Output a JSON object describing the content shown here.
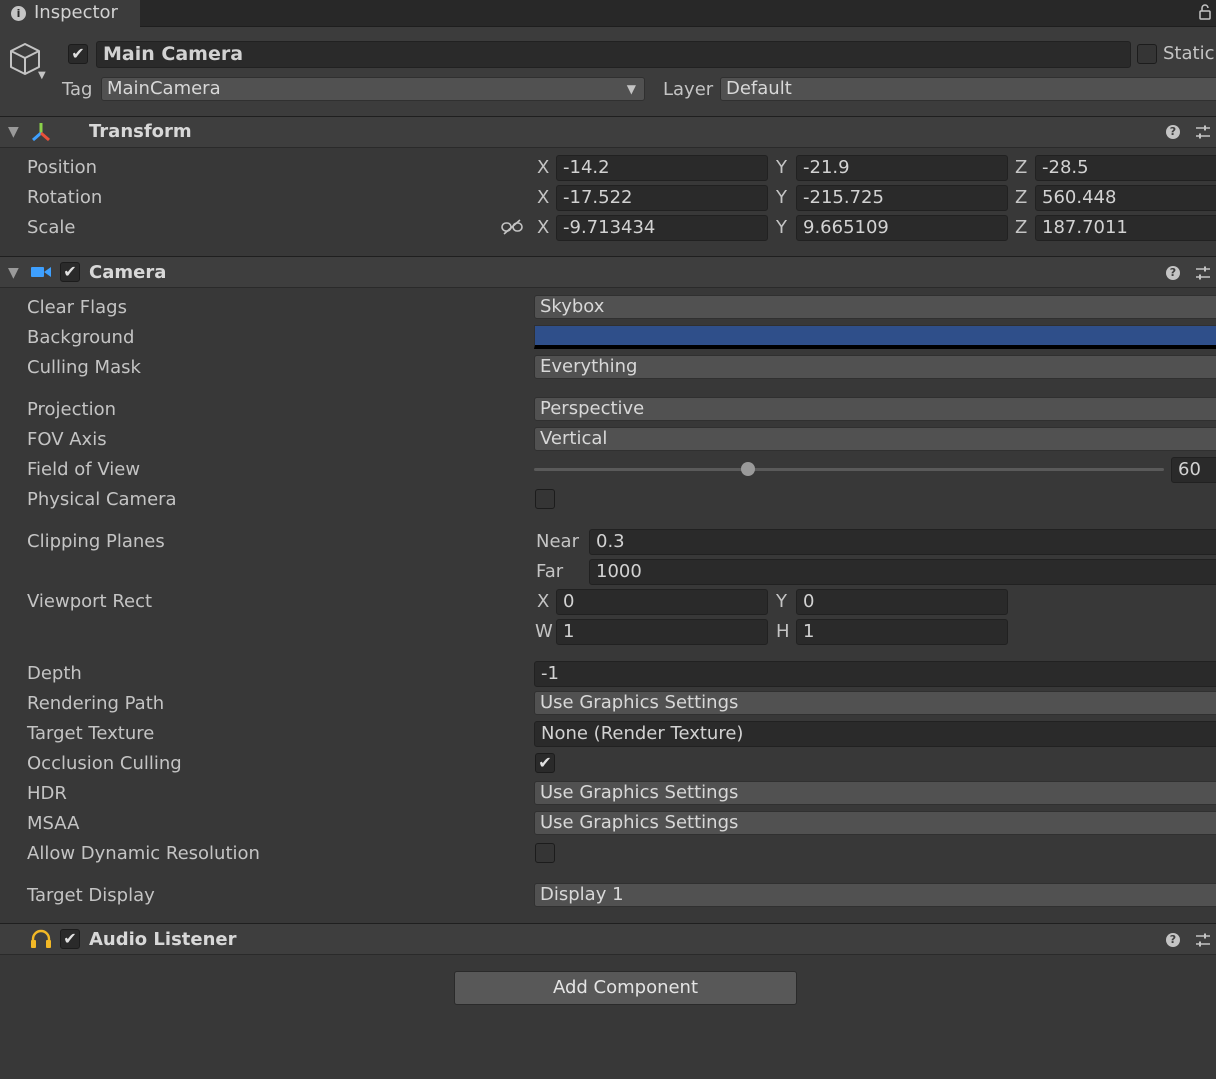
{
  "tab": {
    "title": "Inspector"
  },
  "object": {
    "name": "Main Camera",
    "static_label": "Static",
    "tag_label": "Tag",
    "tag_value": "MainCamera",
    "layer_label": "Layer",
    "layer_value": "Default"
  },
  "transform": {
    "title": "Transform",
    "position": {
      "label": "Position",
      "x": "-14.2",
      "y": "-21.9",
      "z": "-28.5"
    },
    "rotation": {
      "label": "Rotation",
      "x": "-17.522",
      "y": "-215.725",
      "z": "560.448"
    },
    "scale": {
      "label": "Scale",
      "x": "-9.713434",
      "y": "9.665109",
      "z": "187.7011"
    },
    "axis": {
      "x": "X",
      "y": "Y",
      "z": "Z",
      "w": "W",
      "h": "H"
    }
  },
  "camera": {
    "title": "Camera",
    "clear_flags": {
      "label": "Clear Flags",
      "value": "Skybox"
    },
    "background": {
      "label": "Background",
      "color": "#2f4f8a"
    },
    "culling_mask": {
      "label": "Culling Mask",
      "value": "Everything"
    },
    "projection": {
      "label": "Projection",
      "value": "Perspective"
    },
    "fov_axis": {
      "label": "FOV Axis",
      "value": "Vertical"
    },
    "field_of_view": {
      "label": "Field of View",
      "value": "60",
      "slider_fraction": 0.34
    },
    "physical_camera": {
      "label": "Physical Camera",
      "checked": false
    },
    "clipping": {
      "label": "Clipping Planes",
      "near_label": "Near",
      "near": "0.3",
      "far_label": "Far",
      "far": "1000"
    },
    "viewport": {
      "label": "Viewport Rect",
      "x": "0",
      "y": "0",
      "w": "1",
      "h": "1"
    },
    "depth": {
      "label": "Depth",
      "value": "-1"
    },
    "rendering_path": {
      "label": "Rendering Path",
      "value": "Use Graphics Settings"
    },
    "target_texture": {
      "label": "Target Texture",
      "value": "None (Render Texture)"
    },
    "occlusion_culling": {
      "label": "Occlusion Culling",
      "checked": true
    },
    "hdr": {
      "label": "HDR",
      "value": "Use Graphics Settings"
    },
    "msaa": {
      "label": "MSAA",
      "value": "Use Graphics Settings"
    },
    "dynamic_resolution": {
      "label": "Allow Dynamic Resolution",
      "checked": false
    },
    "target_display": {
      "label": "Target Display",
      "value": "Display 1"
    }
  },
  "audio_listener": {
    "title": "Audio Listener"
  },
  "add_component": {
    "label": "Add Component"
  },
  "colors": {
    "accent_blue": "#3ea0ff",
    "audio_yellow": "#f2b826"
  }
}
